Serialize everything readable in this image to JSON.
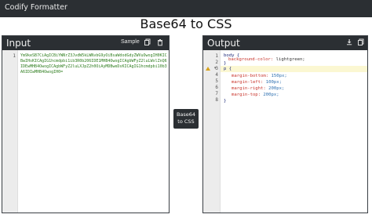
{
  "app": {
    "title": "Codify Formatter"
  },
  "page": {
    "title": "Base64 to CSS"
  },
  "input_panel": {
    "title": "Input",
    "sample_label": "Sample",
    "copy_icon": "copy-icon",
    "delete_icon": "trash-icon",
    "line_numbers": [
      "1"
    ],
    "content": "Ym9keSB7CiAgICBiYWNrZ3JvdW5kLWNvbG9yOiBsaWdodGdyZWVuOwogIH0KICBwIHsKICAgIG1hcmdpbi1ib3R0b206IDE1MHB4OwogICAgbWFyZ2luLWxlZnQ6IDEwMHB4OwogICAgbWFyZ2luLXJpZ2h0OiAyMDBweDsKICAgIG1hcmdpbi10b3A6IDIwMHB4OwogIH0="
  },
  "convert_button": {
    "line1": "Base64",
    "line2": "to CSS"
  },
  "output_panel": {
    "title": "Output",
    "download_icon": "download-icon",
    "copy_icon": "copy-icon",
    "line_numbers": [
      "1",
      "2",
      "3",
      "4",
      "5",
      "6",
      "7",
      "8"
    ],
    "code": {
      "l1_selector": "body {",
      "l2_prop": "background-color:",
      "l2_val": " lightgreen;",
      "l3": "}",
      "l4": "p {",
      "l5_prop": "margin-bottom:",
      "l5_val": " 150px;",
      "l6_prop": "margin-left:",
      "l6_val": " 100px;",
      "l7_prop": "margin-right:",
      "l7_val": " 200px;",
      "l8_prop": "margin-top:",
      "l8_val": " 200px;",
      "l9": "}"
    }
  }
}
